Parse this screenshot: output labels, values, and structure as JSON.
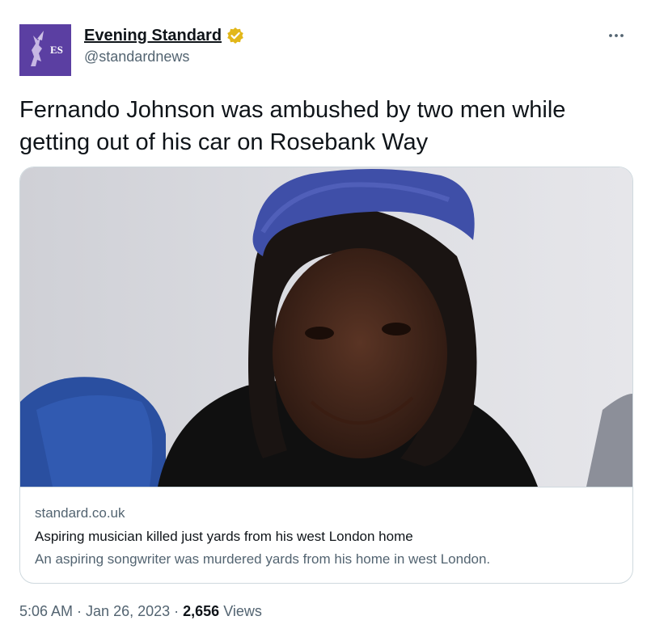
{
  "author": {
    "display_name": "Evening Standard",
    "handle": "@standardnews",
    "avatar_text": "ES",
    "verified_icon": "verified-gold-badge"
  },
  "more_icon": "more-options-icon",
  "tweet": {
    "text": "Fernando Johnson was ambushed by two men while getting out of his car on Rosebank Way"
  },
  "card": {
    "image_icon": "article-photo",
    "domain": "standard.co.uk",
    "title": "Aspiring musician killed just yards from his west London home",
    "description": "An aspiring songwriter was murdered yards from his home in west London."
  },
  "footer": {
    "time": "5:06 AM",
    "date": "Jan 26, 2023",
    "separator": " · ",
    "views_count": "2,656",
    "views_label": " Views"
  },
  "colors": {
    "avatar_bg": "#5b3fa2",
    "verified_gold": "#e2b719",
    "secondary_text": "#536471",
    "border": "#cfd9de"
  }
}
